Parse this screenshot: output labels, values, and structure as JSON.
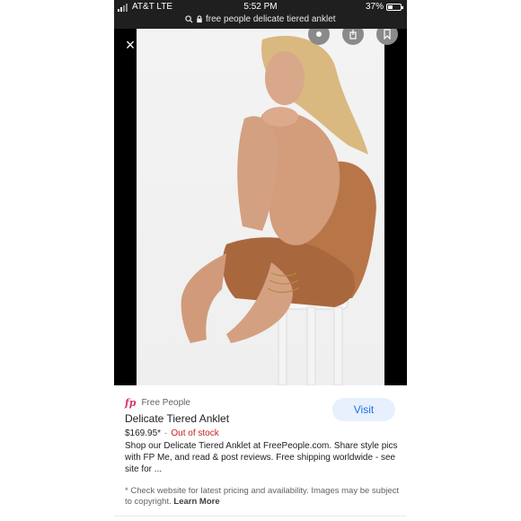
{
  "status_bar": {
    "carrier": "AT&T LTE",
    "time": "5:52 PM",
    "battery_percent": "37%",
    "battery_level": 0.37,
    "url": "free people delicate tiered anklet"
  },
  "viewer": {
    "close_label": "×"
  },
  "result": {
    "source": "Free People",
    "title": "Delicate Tiered Anklet",
    "visit_label": "Visit",
    "price": "$169.95*",
    "separator": "·",
    "stock": "Out of stock",
    "description": "Shop our Delicate Tiered Anklet at FreePeople.com. Share style pics with FP Me, and read & post reviews. Free shipping worldwide - see site for ...",
    "note": "* Check website for latest pricing and availability. Images may be subject to copyright.",
    "learn_more": "Learn More"
  },
  "colors": {
    "accent": "#1a73e8",
    "out_of_stock": "#c5221f",
    "brand": "#d6336c"
  }
}
